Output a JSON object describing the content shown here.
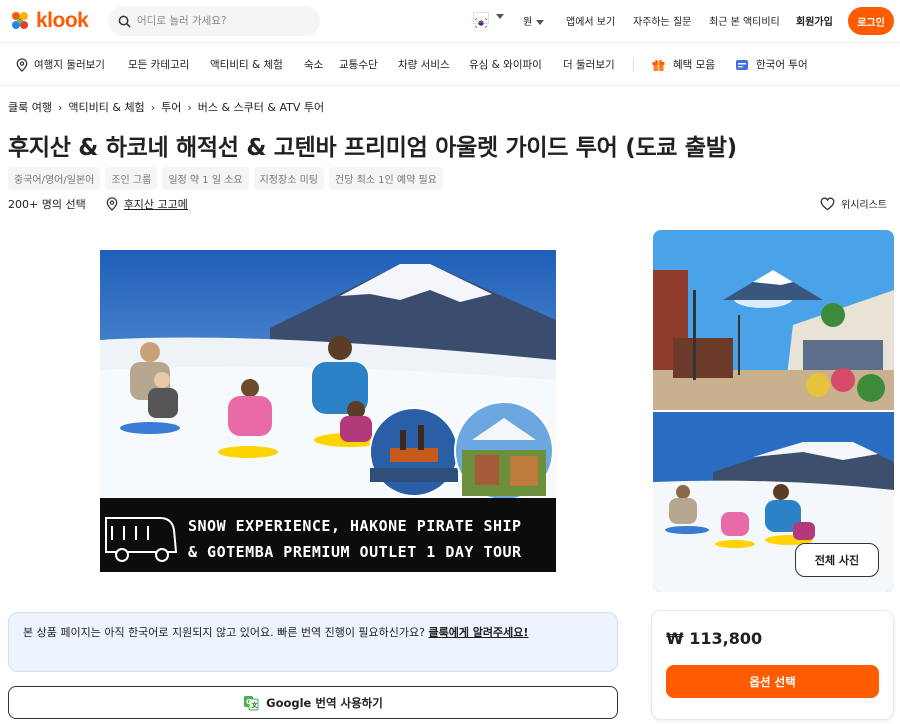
{
  "header": {
    "logo_text": "klook",
    "search_placeholder": "어디로 놀러 가세요?",
    "currency": "원",
    "links": [
      "앱에서 보기",
      "자주하는 질문",
      "최근 본 액티비티",
      "회원가입"
    ],
    "login_label": "로그인"
  },
  "nav": {
    "items": [
      "여행지 둘러보기",
      "모든 카테고리",
      "액티비티 & 체험",
      "숙소",
      "교통수단",
      "차량 서비스",
      "유심 & 와이파이",
      "더 둘러보기"
    ],
    "promo": "혜택 모음",
    "korean_tour": "한국어 투어"
  },
  "breadcrumb": [
    "클룩 여행",
    "액티비티 & 체험",
    "투어",
    "버스 & 스쿠터 & ATV 투어"
  ],
  "product": {
    "title": "후지산 & 하코네 해적선 & 고텐바 프리미엄 아울렛 가이드 투어 (도쿄 출발)",
    "tags": [
      "중국어/영어/일본어",
      "조인 그룹",
      "일정 약 1 일 소요",
      "지정장소 미팅",
      "건당 최소 1인 예약 필요"
    ],
    "selections": "200+ 명의 선택",
    "location": "후지산 고고메",
    "wishlist_label": "위시리스트",
    "banner_line1": "SNOW EXPERIENCE, HAKONE PIRATE SHIP",
    "banner_line2": "& GOTEMBA PREMIUM OUTLET 1 DAY TOUR",
    "all_photos_label": "전체 사진"
  },
  "notice": {
    "text": "본 상품 페이지는 아직 한국어로 지원되지 않고 있어요. 빠른 번역 진행이 필요하신가요? ",
    "link": "클룩에게 알려주세요!"
  },
  "translate_button": "Google 번역 사용하기",
  "booking": {
    "price": "₩ 113,800",
    "select_label": "옵션 선택"
  },
  "colors": {
    "accent": "#ff5b00",
    "notice_bg": "#eef4ff"
  }
}
